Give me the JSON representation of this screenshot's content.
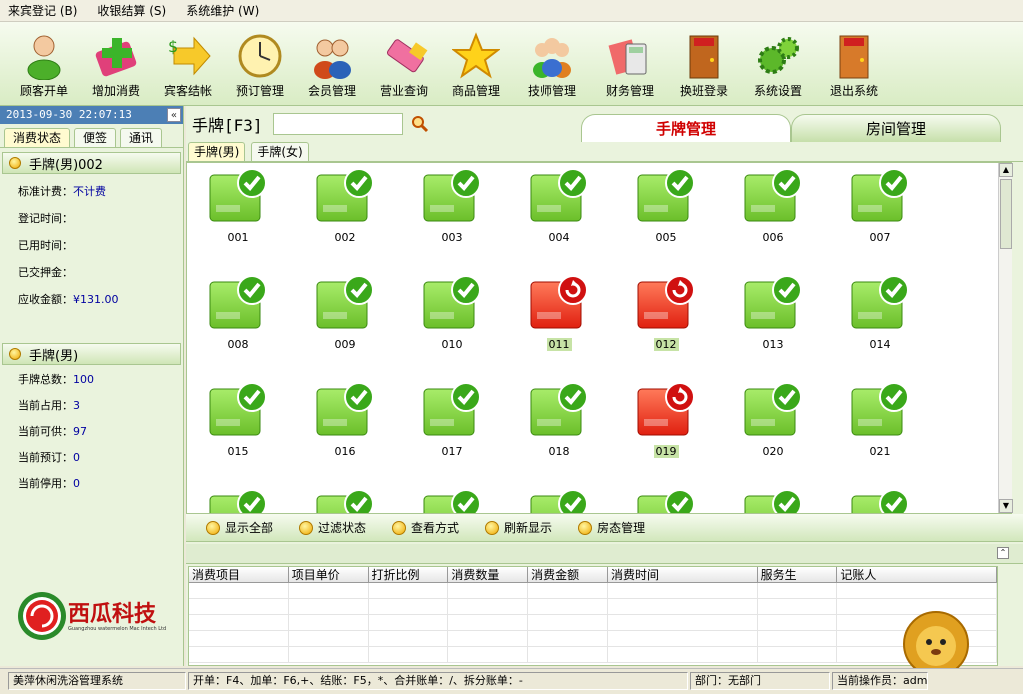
{
  "menu": [
    "来宾登记 (B)",
    "收银结算 (S)",
    "系统维护 (W)"
  ],
  "toolbar": [
    {
      "label": "顾客开单",
      "icon": "person-icon"
    },
    {
      "label": "增加消费",
      "icon": "add-cross-icon"
    },
    {
      "label": "宾客结帐",
      "icon": "money-arrow-icon"
    },
    {
      "label": "预订管理",
      "icon": "clock-icon"
    },
    {
      "label": "会员管理",
      "icon": "members-icon"
    },
    {
      "label": "营业查询",
      "icon": "eraser-icon"
    },
    {
      "label": "商品管理",
      "icon": "star-icon"
    },
    {
      "label": "技师管理",
      "icon": "group-icon"
    },
    {
      "label": "财务管理",
      "icon": "calculator-icon"
    },
    {
      "label": "换班登录",
      "icon": "exit-door-icon"
    },
    {
      "label": "系统设置",
      "icon": "gears-icon"
    },
    {
      "label": "退出系统",
      "icon": "exit-door2-icon"
    }
  ],
  "left": {
    "datetime": "2013-09-30  22:07:13",
    "collapse": "«",
    "tabs": [
      "消费状态",
      "便签",
      "通讯"
    ],
    "section1": {
      "title": "手牌(男)002",
      "rows": [
        {
          "label": "标准计费：",
          "value": "不计费"
        },
        {
          "label": "登记时间：",
          "value": ""
        },
        {
          "label": "已用时间：",
          "value": ""
        },
        {
          "label": "已交押金：",
          "value": ""
        },
        {
          "label": "应收金额：",
          "value": "¥131.00"
        }
      ]
    },
    "section2": {
      "title": "手牌(男)",
      "rows": [
        {
          "label": "手牌总数：",
          "value": "100"
        },
        {
          "label": "当前占用：",
          "value": "3"
        },
        {
          "label": "当前可供：",
          "value": "97"
        },
        {
          "label": "当前预订：",
          "value": "0"
        },
        {
          "label": "当前停用：",
          "value": "0"
        }
      ]
    },
    "logo_text": "西瓜科技",
    "logo_sub": "Guangzhou watermelon Mac Intech Ltd"
  },
  "main": {
    "title": "手牌[F3]",
    "search_value": "",
    "tab_active": "手牌管理",
    "tab_inactive": "房间管理",
    "subtabs": [
      "手牌(男)",
      "手牌(女)"
    ],
    "tiles": [
      {
        "n": "001",
        "s": "free"
      },
      {
        "n": "002",
        "s": "free"
      },
      {
        "n": "003",
        "s": "free"
      },
      {
        "n": "004",
        "s": "free"
      },
      {
        "n": "005",
        "s": "free"
      },
      {
        "n": "006",
        "s": "free"
      },
      {
        "n": "007",
        "s": "free"
      },
      {
        "n": "008",
        "s": "free"
      },
      {
        "n": "009",
        "s": "free"
      },
      {
        "n": "010",
        "s": "free"
      },
      {
        "n": "011",
        "s": "busy"
      },
      {
        "n": "012",
        "s": "busy"
      },
      {
        "n": "013",
        "s": "free"
      },
      {
        "n": "014",
        "s": "free"
      },
      {
        "n": "015",
        "s": "free"
      },
      {
        "n": "016",
        "s": "free"
      },
      {
        "n": "017",
        "s": "free"
      },
      {
        "n": "018",
        "s": "free"
      },
      {
        "n": "019",
        "s": "busy"
      },
      {
        "n": "020",
        "s": "free"
      },
      {
        "n": "021",
        "s": "free"
      },
      {
        "n": "",
        "s": "free"
      },
      {
        "n": "",
        "s": "free"
      },
      {
        "n": "",
        "s": "free"
      },
      {
        "n": "",
        "s": "free"
      },
      {
        "n": "",
        "s": "free"
      },
      {
        "n": "",
        "s": "free"
      },
      {
        "n": "",
        "s": "free"
      }
    ],
    "actions": [
      "显示全部",
      "过滤状态",
      "查看方式",
      "刷新显示",
      "房态管理"
    ],
    "table_headers": [
      "消费项目",
      "项目单价",
      "打折比例",
      "消费数量",
      "消费金额",
      "消费时间",
      "服务生",
      "记账人"
    ]
  },
  "status": {
    "system": "美萍休闲洗浴管理系统",
    "hint": "开单：F4、加单：F6,+、结账：F5，*、合并账单：/、拆分账单：-",
    "dept": "部门：无部门",
    "operator": "当前操作员：admin"
  },
  "colors": {
    "accent_green": "#6bbf2a",
    "busy_red": "#e02010",
    "active_tab_text": "#d00000"
  }
}
